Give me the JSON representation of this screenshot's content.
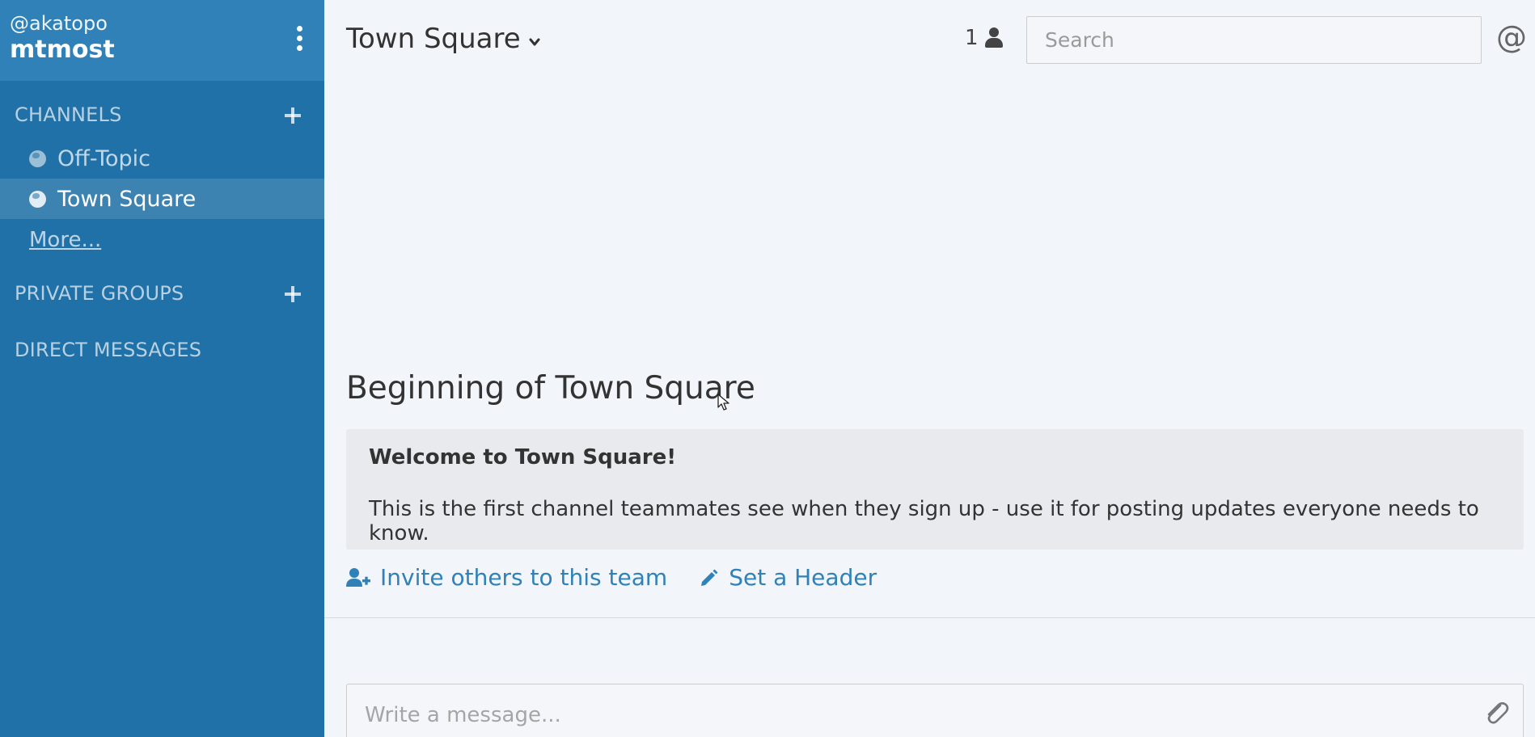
{
  "team": {
    "username": "@akatopo",
    "name": "mtmost"
  },
  "sidebar": {
    "channels_header": "CHANNELS",
    "channels": [
      {
        "label": "Off-Topic",
        "active": false
      },
      {
        "label": "Town Square",
        "active": true
      }
    ],
    "more_label": "More...",
    "private_groups_header": "PRIVATE GROUPS",
    "direct_messages_header": "DIRECT MESSAGES"
  },
  "header": {
    "channel_title": "Town Square",
    "member_count": "1",
    "search_placeholder": "Search",
    "mention_symbol": "@"
  },
  "intro": {
    "title": "Beginning of Town Square",
    "welcome_heading": "Welcome to Town Square!",
    "welcome_body": "This is the first channel teammates see when they sign up - use it for posting updates everyone needs to know.",
    "invite_label": "Invite others to this team",
    "set_header_label": "Set a Header"
  },
  "composer": {
    "placeholder": "Write a message..."
  },
  "colors": {
    "sidebar_bg": "#2071a7",
    "team_header_bg": "#2f81b7",
    "link": "#2f81b7",
    "main_bg": "#f2f5f9"
  },
  "icons": [
    "menu-dots-icon",
    "plus-icon",
    "globe-icon",
    "chevron-down-icon",
    "user-icon",
    "at-icon",
    "user-plus-icon",
    "pencil-icon",
    "paperclip-icon"
  ]
}
